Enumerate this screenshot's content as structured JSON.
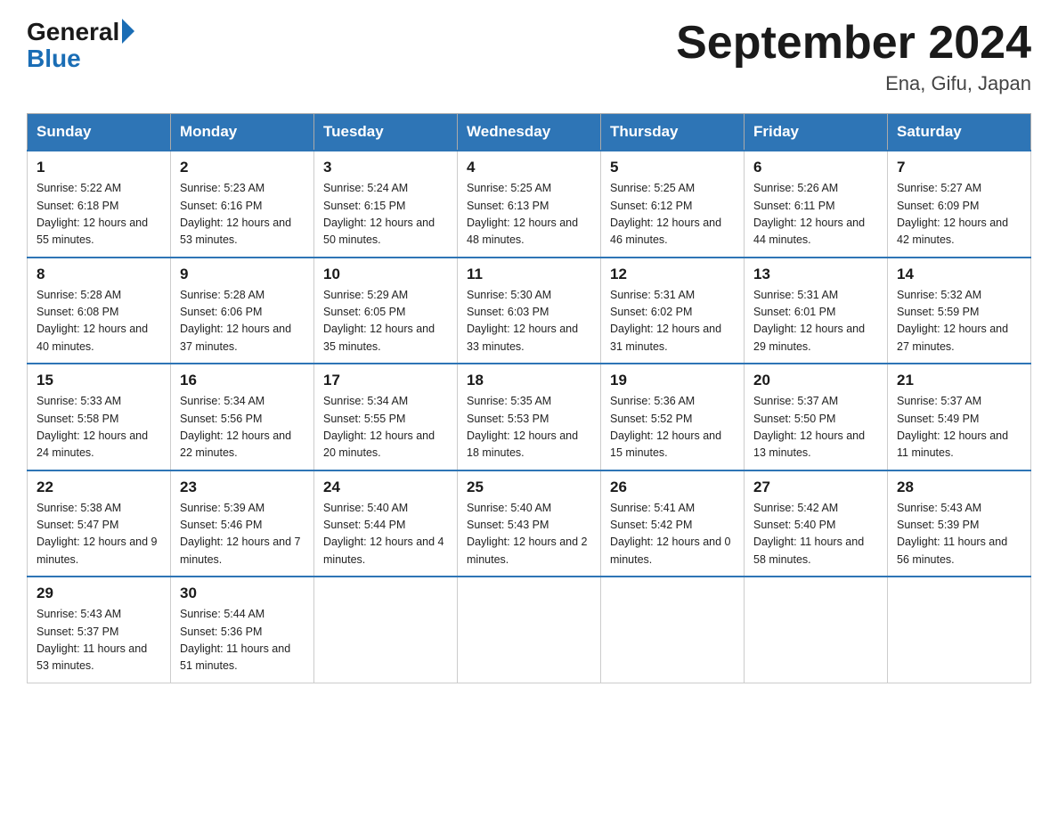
{
  "header": {
    "logo_general": "General",
    "logo_blue": "Blue",
    "month_title": "September 2024",
    "location": "Ena, Gifu, Japan"
  },
  "weekdays": [
    "Sunday",
    "Monday",
    "Tuesday",
    "Wednesday",
    "Thursday",
    "Friday",
    "Saturday"
  ],
  "weeks": [
    [
      {
        "day": "1",
        "sunrise": "Sunrise: 5:22 AM",
        "sunset": "Sunset: 6:18 PM",
        "daylight": "Daylight: 12 hours and 55 minutes."
      },
      {
        "day": "2",
        "sunrise": "Sunrise: 5:23 AM",
        "sunset": "Sunset: 6:16 PM",
        "daylight": "Daylight: 12 hours and 53 minutes."
      },
      {
        "day": "3",
        "sunrise": "Sunrise: 5:24 AM",
        "sunset": "Sunset: 6:15 PM",
        "daylight": "Daylight: 12 hours and 50 minutes."
      },
      {
        "day": "4",
        "sunrise": "Sunrise: 5:25 AM",
        "sunset": "Sunset: 6:13 PM",
        "daylight": "Daylight: 12 hours and 48 minutes."
      },
      {
        "day": "5",
        "sunrise": "Sunrise: 5:25 AM",
        "sunset": "Sunset: 6:12 PM",
        "daylight": "Daylight: 12 hours and 46 minutes."
      },
      {
        "day": "6",
        "sunrise": "Sunrise: 5:26 AM",
        "sunset": "Sunset: 6:11 PM",
        "daylight": "Daylight: 12 hours and 44 minutes."
      },
      {
        "day": "7",
        "sunrise": "Sunrise: 5:27 AM",
        "sunset": "Sunset: 6:09 PM",
        "daylight": "Daylight: 12 hours and 42 minutes."
      }
    ],
    [
      {
        "day": "8",
        "sunrise": "Sunrise: 5:28 AM",
        "sunset": "Sunset: 6:08 PM",
        "daylight": "Daylight: 12 hours and 40 minutes."
      },
      {
        "day": "9",
        "sunrise": "Sunrise: 5:28 AM",
        "sunset": "Sunset: 6:06 PM",
        "daylight": "Daylight: 12 hours and 37 minutes."
      },
      {
        "day": "10",
        "sunrise": "Sunrise: 5:29 AM",
        "sunset": "Sunset: 6:05 PM",
        "daylight": "Daylight: 12 hours and 35 minutes."
      },
      {
        "day": "11",
        "sunrise": "Sunrise: 5:30 AM",
        "sunset": "Sunset: 6:03 PM",
        "daylight": "Daylight: 12 hours and 33 minutes."
      },
      {
        "day": "12",
        "sunrise": "Sunrise: 5:31 AM",
        "sunset": "Sunset: 6:02 PM",
        "daylight": "Daylight: 12 hours and 31 minutes."
      },
      {
        "day": "13",
        "sunrise": "Sunrise: 5:31 AM",
        "sunset": "Sunset: 6:01 PM",
        "daylight": "Daylight: 12 hours and 29 minutes."
      },
      {
        "day": "14",
        "sunrise": "Sunrise: 5:32 AM",
        "sunset": "Sunset: 5:59 PM",
        "daylight": "Daylight: 12 hours and 27 minutes."
      }
    ],
    [
      {
        "day": "15",
        "sunrise": "Sunrise: 5:33 AM",
        "sunset": "Sunset: 5:58 PM",
        "daylight": "Daylight: 12 hours and 24 minutes."
      },
      {
        "day": "16",
        "sunrise": "Sunrise: 5:34 AM",
        "sunset": "Sunset: 5:56 PM",
        "daylight": "Daylight: 12 hours and 22 minutes."
      },
      {
        "day": "17",
        "sunrise": "Sunrise: 5:34 AM",
        "sunset": "Sunset: 5:55 PM",
        "daylight": "Daylight: 12 hours and 20 minutes."
      },
      {
        "day": "18",
        "sunrise": "Sunrise: 5:35 AM",
        "sunset": "Sunset: 5:53 PM",
        "daylight": "Daylight: 12 hours and 18 minutes."
      },
      {
        "day": "19",
        "sunrise": "Sunrise: 5:36 AM",
        "sunset": "Sunset: 5:52 PM",
        "daylight": "Daylight: 12 hours and 15 minutes."
      },
      {
        "day": "20",
        "sunrise": "Sunrise: 5:37 AM",
        "sunset": "Sunset: 5:50 PM",
        "daylight": "Daylight: 12 hours and 13 minutes."
      },
      {
        "day": "21",
        "sunrise": "Sunrise: 5:37 AM",
        "sunset": "Sunset: 5:49 PM",
        "daylight": "Daylight: 12 hours and 11 minutes."
      }
    ],
    [
      {
        "day": "22",
        "sunrise": "Sunrise: 5:38 AM",
        "sunset": "Sunset: 5:47 PM",
        "daylight": "Daylight: 12 hours and 9 minutes."
      },
      {
        "day": "23",
        "sunrise": "Sunrise: 5:39 AM",
        "sunset": "Sunset: 5:46 PM",
        "daylight": "Daylight: 12 hours and 7 minutes."
      },
      {
        "day": "24",
        "sunrise": "Sunrise: 5:40 AM",
        "sunset": "Sunset: 5:44 PM",
        "daylight": "Daylight: 12 hours and 4 minutes."
      },
      {
        "day": "25",
        "sunrise": "Sunrise: 5:40 AM",
        "sunset": "Sunset: 5:43 PM",
        "daylight": "Daylight: 12 hours and 2 minutes."
      },
      {
        "day": "26",
        "sunrise": "Sunrise: 5:41 AM",
        "sunset": "Sunset: 5:42 PM",
        "daylight": "Daylight: 12 hours and 0 minutes."
      },
      {
        "day": "27",
        "sunrise": "Sunrise: 5:42 AM",
        "sunset": "Sunset: 5:40 PM",
        "daylight": "Daylight: 11 hours and 58 minutes."
      },
      {
        "day": "28",
        "sunrise": "Sunrise: 5:43 AM",
        "sunset": "Sunset: 5:39 PM",
        "daylight": "Daylight: 11 hours and 56 minutes."
      }
    ],
    [
      {
        "day": "29",
        "sunrise": "Sunrise: 5:43 AM",
        "sunset": "Sunset: 5:37 PM",
        "daylight": "Daylight: 11 hours and 53 minutes."
      },
      {
        "day": "30",
        "sunrise": "Sunrise: 5:44 AM",
        "sunset": "Sunset: 5:36 PM",
        "daylight": "Daylight: 11 hours and 51 minutes."
      },
      null,
      null,
      null,
      null,
      null
    ]
  ]
}
